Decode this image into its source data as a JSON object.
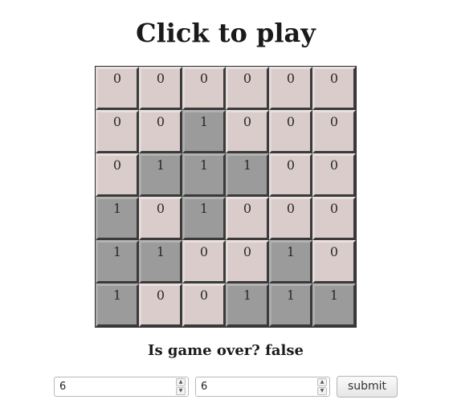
{
  "title": "Click to play",
  "board": {
    "rows": 6,
    "cols": 6,
    "cells": [
      [
        0,
        0,
        0,
        0,
        0,
        0
      ],
      [
        0,
        0,
        1,
        0,
        0,
        0
      ],
      [
        0,
        1,
        1,
        1,
        0,
        0
      ],
      [
        1,
        0,
        1,
        0,
        0,
        0
      ],
      [
        1,
        1,
        0,
        0,
        1,
        0
      ],
      [
        1,
        0,
        0,
        1,
        1,
        1
      ]
    ],
    "colors": {
      "off": "#d9ccca",
      "on": "#9b9b9b",
      "grid": "#2b2b2b"
    }
  },
  "status": {
    "text": "Is game over? false"
  },
  "controls": {
    "rows_value": "6",
    "cols_value": "6",
    "submit_label": "submit",
    "spin_up_icon": "▲",
    "spin_down_icon": "▼"
  }
}
